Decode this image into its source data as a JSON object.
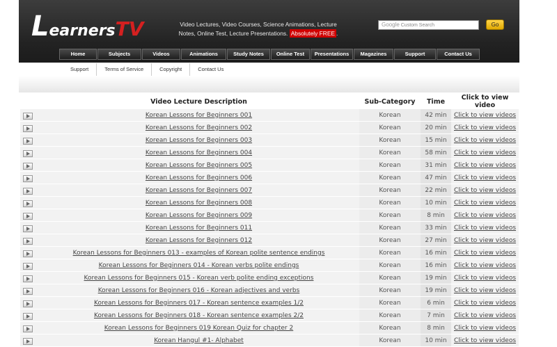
{
  "header": {
    "logo": {
      "l": "L",
      "rest": "earners",
      "tv": "TV"
    },
    "tagline_line1": "Video Lectures, Video Courses, Science Animations, Lecture",
    "tagline_line2": "Notes, Online Test, Lecture Presentations.",
    "tagline_free": "Absolutely FREE",
    "tagline_end": ".",
    "search_brand": "Google",
    "search_placeholder": "Custom Search",
    "go_label": "Go"
  },
  "nav": {
    "items": [
      "Home",
      "Subjects",
      "Videos",
      "Animations",
      "Study Notes",
      "Online Test",
      "Presentations",
      "Magazines",
      "Support",
      "Contact Us"
    ]
  },
  "subnav": {
    "items": [
      "Support",
      "Terms of Service",
      "Copyright",
      "Contact Us"
    ]
  },
  "table": {
    "headers": {
      "description": "Video Lecture Description",
      "subcategory": "Sub-Category",
      "time": "Time",
      "link": "Click to view video"
    },
    "rows": [
      {
        "title": "Korean Lessons for Beginners 001",
        "sub": "Korean",
        "time": "42 min",
        "link": "Click to view videos"
      },
      {
        "title": "Korean Lessons for Beginners 002",
        "sub": "Korean",
        "time": "20 min",
        "link": "Click to view videos"
      },
      {
        "title": "Korean Lessons for Beginners 003",
        "sub": "Korean",
        "time": "15 min",
        "link": "Click to view videos"
      },
      {
        "title": "Korean Lessons for Beginners 004",
        "sub": "Korean",
        "time": "58 min",
        "link": "Click to view videos"
      },
      {
        "title": "Korean Lessons for Beginners 005",
        "sub": "Korean",
        "time": "31 min",
        "link": "Click to view videos"
      },
      {
        "title": "Korean Lessons for Beginners 006",
        "sub": "Korean",
        "time": "47 min",
        "link": "Click to view videos"
      },
      {
        "title": "Korean Lessons for Beginners 007",
        "sub": "Korean",
        "time": "22 min",
        "link": "Click to view videos"
      },
      {
        "title": "Korean Lessons for Beginners 008",
        "sub": "Korean",
        "time": "10 min",
        "link": "Click to view videos"
      },
      {
        "title": "Korean Lessons for Beginners 009",
        "sub": "Korean",
        "time": "8 min",
        "link": "Click to view videos"
      },
      {
        "title": "Korean Lessons for Beginners 011",
        "sub": "Korean",
        "time": "33 min",
        "link": "Click to view videos"
      },
      {
        "title": "Korean Lessons for Beginners 012",
        "sub": "Korean",
        "time": "27 min",
        "link": "Click to view videos"
      },
      {
        "title": "Korean Lessons for Beginners 013 - examples of Korean polite sentence endings",
        "sub": "Korean",
        "time": "16 min",
        "link": "Click to view videos"
      },
      {
        "title": "Korean Lessons for Beginners 014 - Korean verbs polite endings",
        "sub": "Korean",
        "time": "16 min",
        "link": "Click to view videos"
      },
      {
        "title": "Korean Lessons for Beginners 015 - Korean verb polite ending exceptions",
        "sub": "Korean",
        "time": "19 min",
        "link": "Click to view videos"
      },
      {
        "title": "Korean Lessons for Beginners 016 - Korean adjectives and verbs",
        "sub": "Korean",
        "time": "19 min",
        "link": "Click to view videos"
      },
      {
        "title": "Korean Lessons for Beginners 017 - Korean sentence examples 1/2",
        "sub": "Korean",
        "time": "6 min",
        "link": "Click to view videos"
      },
      {
        "title": "Korean Lessons for Beginners 018 - Korean sentence examples 2/2",
        "sub": "Korean",
        "time": "7 min",
        "link": "Click to view videos"
      },
      {
        "title": "Korean Lessons for Beginners 019 Korean Quiz for chapter 2",
        "sub": "Korean",
        "time": "8 min",
        "link": "Click to view videos"
      },
      {
        "title": "Korean Hangul #1- Alphabet",
        "sub": "Korean",
        "time": "10 min",
        "link": "Click to view videos"
      }
    ]
  }
}
